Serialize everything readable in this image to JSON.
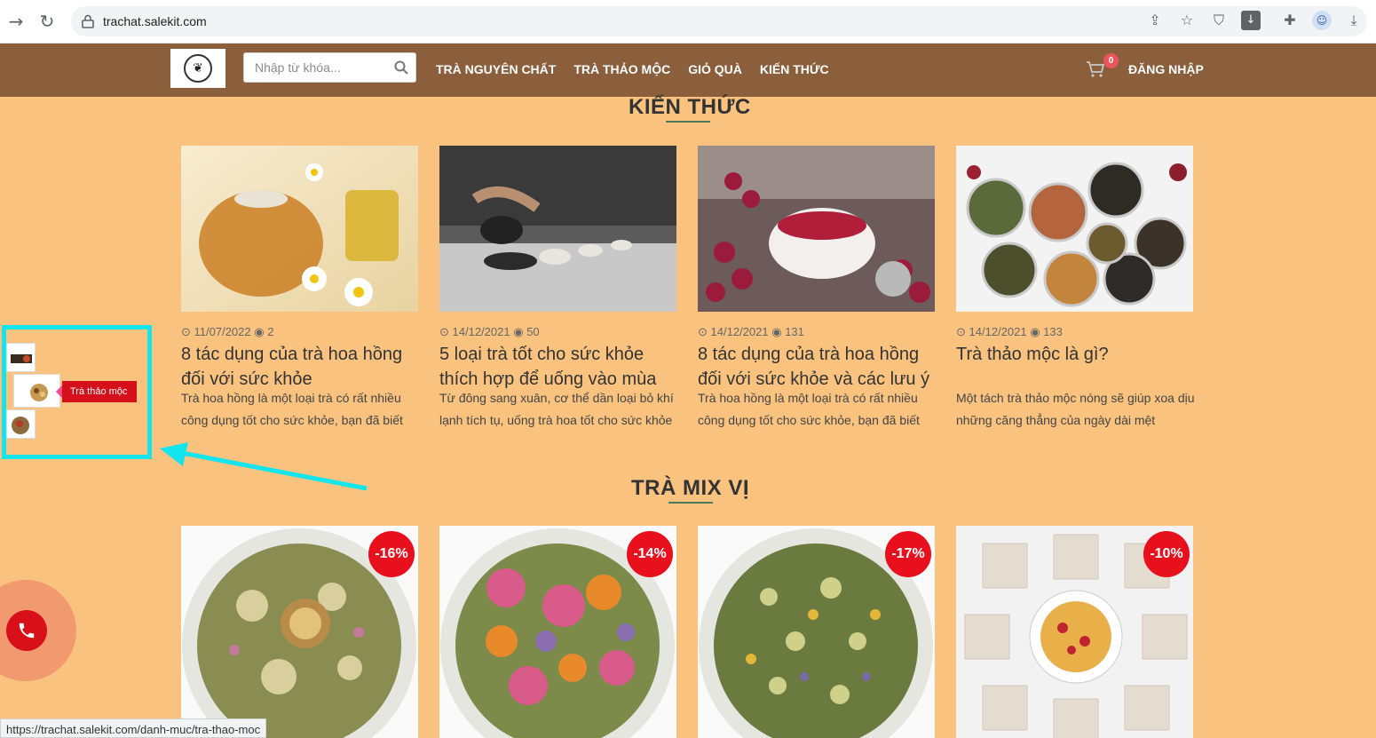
{
  "browser": {
    "back_icon": "arrow-right-icon",
    "reload_icon": "reload-icon",
    "url": "trachat.salekit.com",
    "status_url": "https://trachat.salekit.com/danh-muc/tra-thao-moc"
  },
  "header": {
    "search_placeholder": "Nhập từ khóa...",
    "nav": [
      "TRÀ NGUYÊN CHẤT",
      "TRÀ THẢO MỘC",
      "GIỎ QUÀ",
      "KIẾN THỨC"
    ],
    "cart_count": "0",
    "login_label": "ĐĂNG NHẬP"
  },
  "knowledge": {
    "title": "KIẾN THỨC",
    "posts": [
      {
        "date": "11/07/2022",
        "views": "2",
        "title": "8 tác dụng của trà hoa hồng đối với sức khỏe",
        "excerpt": "Trà hoa hồng là một loại trà có rất nhiều công dụng tốt cho sức khỏe, bạn đã biết"
      },
      {
        "date": "14/12/2021",
        "views": "50",
        "title": "5 loại trà tốt cho sức khỏe thích hợp để uống vào mùa",
        "excerpt": "Từ đông sang xuân, cơ thể dần loại bỏ khí lạnh tích tụ, uống trà hoa tốt cho sức khỏe"
      },
      {
        "date": "14/12/2021",
        "views": "131",
        "title": "8 tác dụng của trà hoa hồng đối với sức khỏe và các lưu ý",
        "excerpt": "Trà hoa hồng là một loại trà có rất nhiều công dụng tốt cho sức khỏe, bạn đã biết"
      },
      {
        "date": "14/12/2021",
        "views": "133",
        "title": "Trà thảo mộc là gì?",
        "excerpt": "Một tách trà thảo mộc nóng sẽ giúp xoa dịu những căng thẳng của ngày dài mệt"
      }
    ]
  },
  "mix": {
    "title": "TRÀ MIX VỊ",
    "products": [
      {
        "discount": "-16%"
      },
      {
        "discount": "-14%"
      },
      {
        "discount": "-17%"
      },
      {
        "discount": "-10%"
      }
    ]
  },
  "side_widget": {
    "tooltip": "Trà thảo mộc"
  },
  "colors": {
    "page_bg": "#f9c27f",
    "header_bg": "#8b5e3c",
    "discount": "#e8101c",
    "highlight": "#14e5ed"
  }
}
